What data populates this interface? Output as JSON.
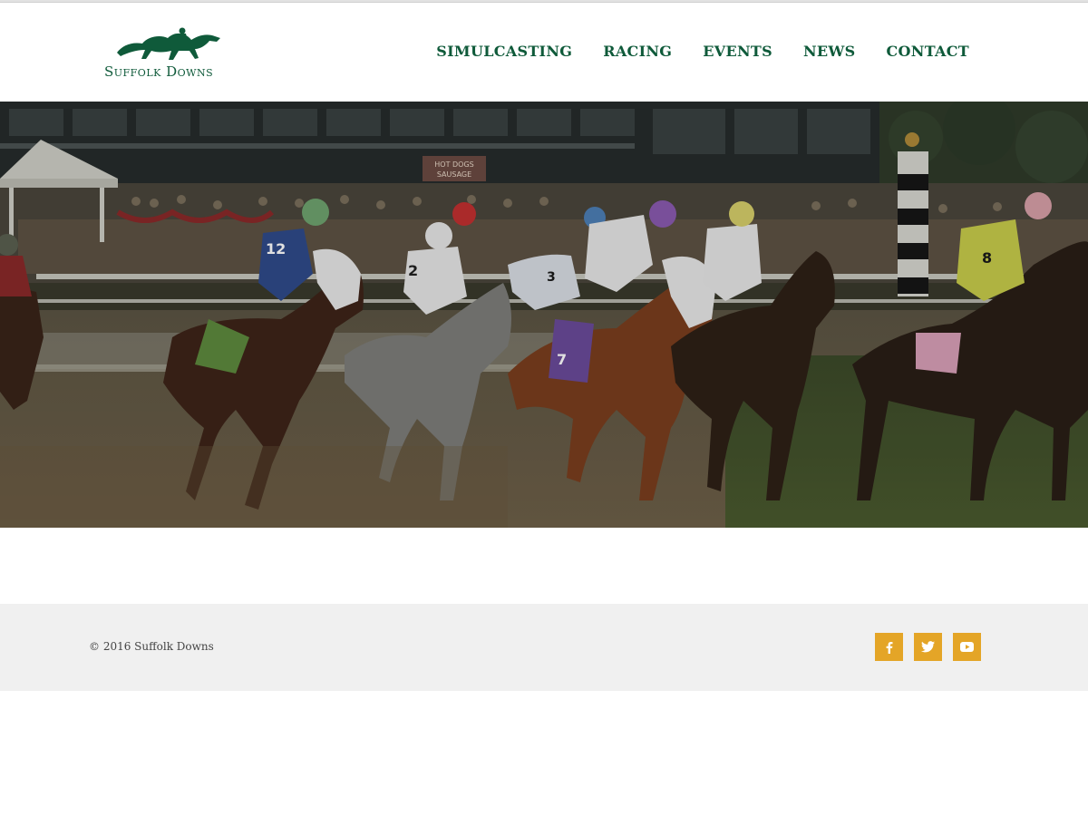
{
  "header": {
    "logo_text": "Suffolk Downs",
    "nav": [
      {
        "label": "SIMULCASTING"
      },
      {
        "label": "RACING"
      },
      {
        "label": "EVENTS"
      },
      {
        "label": "NEWS"
      },
      {
        "label": "CONTACT"
      }
    ]
  },
  "hero": {
    "jockey_numbers": [
      "12",
      "2",
      "3",
      "7",
      "8"
    ],
    "signs": [
      "HOT DOGS SAUSAGE"
    ]
  },
  "footer": {
    "copyright": "© 2016 Suffolk Downs",
    "social": [
      {
        "icon": "facebook-icon"
      },
      {
        "icon": "twitter-icon"
      },
      {
        "icon": "youtube-icon"
      }
    ]
  },
  "colors": {
    "brand_green": "#0f5a3a",
    "social_gold": "#e4a527",
    "footer_bg": "#f0f0f0"
  }
}
